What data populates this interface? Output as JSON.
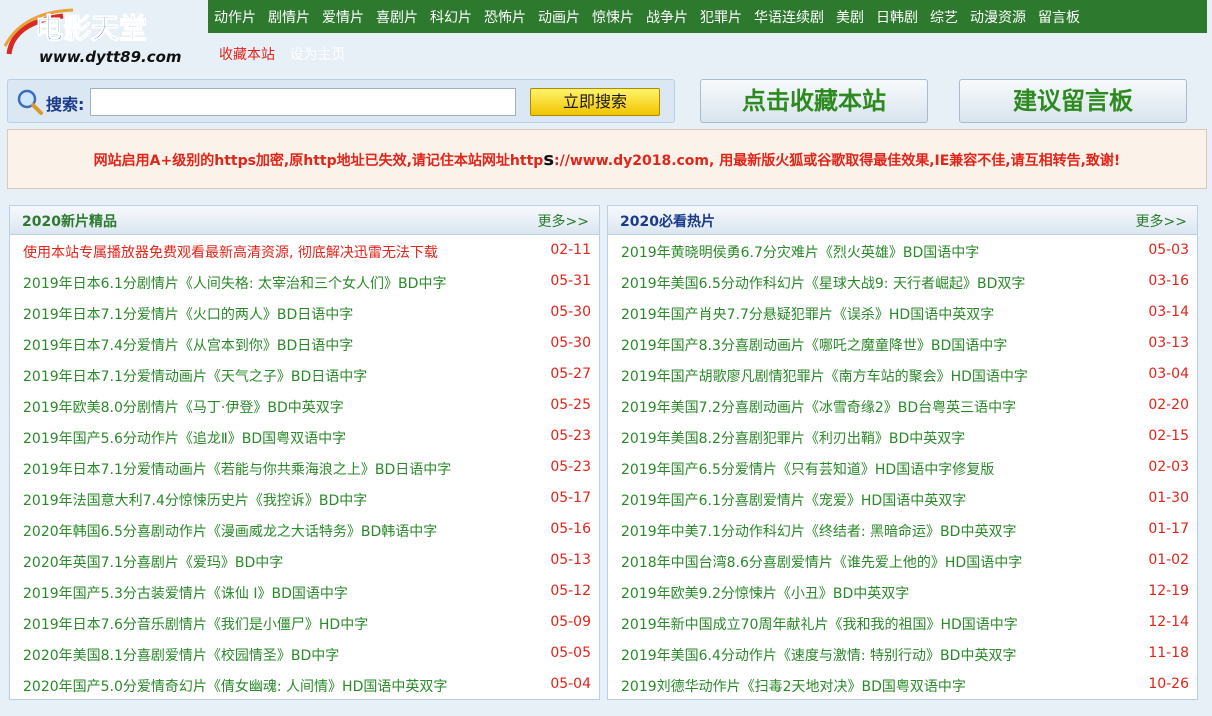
{
  "logo": {
    "text": "电影天堂",
    "url": "www.dytt89.com"
  },
  "nav": [
    "动作片",
    "剧情片",
    "爱情片",
    "喜剧片",
    "科幻片",
    "恐怖片",
    "动画片",
    "惊悚片",
    "战争片",
    "犯罪片",
    "华语连续剧",
    "美剧",
    "日韩剧",
    "综艺",
    "动漫资源",
    "留言板"
  ],
  "sublinks": {
    "bookmark": "收藏本站",
    "homepage": "设为主页"
  },
  "search": {
    "label": "搜索:",
    "placeholder": "",
    "button": "立即搜索"
  },
  "buttons": {
    "bookmark": "点击收藏本站",
    "guestbook": "建议留言板"
  },
  "notice": {
    "part1": "网站启用A+级别的https加密,原http地址已失效,请记住本站网址http",
    "part2": "s",
    "part3": "://www.dy2018.com, 用最新版火狐或谷歌取得最佳效果,IE兼容不佳,请互相转告,致谢!"
  },
  "colors": {
    "nav_bg": "#2d7a2f",
    "link_green": "#2a8a29",
    "date_red": "#e3231a",
    "notice_red": "#e32419"
  },
  "left_panel": {
    "title": "2020新片精品",
    "more": "更多>>",
    "title_color": "#2d7a2f",
    "rows": [
      {
        "title": "使用本站专属播放器免费观看最新高清资源, 彻底解决迅雷无法下载",
        "date": "02-11",
        "highlight": true
      },
      {
        "title": "2019年日本6.1分剧情片《人间失格: 太宰治和三个女人们》BD中字",
        "date": "05-31"
      },
      {
        "title": "2019年日本7.1分爱情片《火口的两人》BD日语中字",
        "date": "05-30"
      },
      {
        "title": "2019年日本7.4分爱情片《从宫本到你》BD日语中字",
        "date": "05-30"
      },
      {
        "title": "2019年日本7.1分爱情动画片《天气之子》BD日语中字",
        "date": "05-27"
      },
      {
        "title": "2019年欧美8.0分剧情片《马丁·伊登》BD中英双字",
        "date": "05-25"
      },
      {
        "title": "2019年国产5.6分动作片《追龙Ⅱ》BD国粤双语中字",
        "date": "05-23"
      },
      {
        "title": "2019年日本7.1分爱情动画片《若能与你共乘海浪之上》BD日语中字",
        "date": "05-23"
      },
      {
        "title": "2019年法国意大利7.4分惊悚历史片《我控诉》BD中字",
        "date": "05-17"
      },
      {
        "title": "2020年韩国6.5分喜剧动作片《漫画威龙之大话特务》BD韩语中字",
        "date": "05-16"
      },
      {
        "title": "2020年英国7.1分喜剧片《爱玛》BD中字",
        "date": "05-13"
      },
      {
        "title": "2019年国产5.3分古装爱情片《诛仙 Ⅰ》BD国语中字",
        "date": "05-12"
      },
      {
        "title": "2019年日本7.6分音乐剧情片《我们是小僵尸》HD中字",
        "date": "05-09"
      },
      {
        "title": "2020年美国8.1分喜剧爱情片《校园情圣》BD中字",
        "date": "05-05"
      },
      {
        "title": "2020年国产5.0分爱情奇幻片《倩女幽魂: 人间情》HD国语中英双字",
        "date": "05-04"
      }
    ]
  },
  "right_panel": {
    "title": "2020必看热片",
    "more": "更多>>",
    "title_color": "#1a3a8a",
    "rows": [
      {
        "title": "2019年黄晓明侯勇6.7分灾难片《烈火英雄》BD国语中字",
        "date": "05-03"
      },
      {
        "title": "2019年美国6.5分动作科幻片《星球大战9: 天行者崛起》BD双字",
        "date": "03-16"
      },
      {
        "title": "2019年国产肖央7.7分悬疑犯罪片《误杀》HD国语中英双字",
        "date": "03-14"
      },
      {
        "title": "2019年国产8.3分喜剧动画片《哪吒之魔童降世》BD国语中字",
        "date": "03-13"
      },
      {
        "title": "2019年国产胡歌廖凡剧情犯罪片《南方车站的聚会》HD国语中字",
        "date": "03-04"
      },
      {
        "title": "2019年美国7.2分喜剧动画片《冰雪奇缘2》BD台粤英三语中字",
        "date": "02-20"
      },
      {
        "title": "2019年美国8.2分喜剧犯罪片《利刃出鞘》BD中英双字",
        "date": "02-15"
      },
      {
        "title": "2019年国产6.5分爱情片《只有芸知道》HD国语中字修复版",
        "date": "02-03"
      },
      {
        "title": "2019年国产6.1分喜剧爱情片《宠爱》HD国语中英双字",
        "date": "01-30"
      },
      {
        "title": "2019年中美7.1分动作科幻片《终结者: 黑暗命运》BD中英双字",
        "date": "01-17"
      },
      {
        "title": "2018年中国台湾8.6分喜剧爱情片《谁先爱上他的》HD国语中字",
        "date": "01-02"
      },
      {
        "title": "2019年欧美9.2分惊悚片《小丑》BD中英双字",
        "date": "12-19"
      },
      {
        "title": "2019年新中国成立70周年献礼片《我和我的祖国》HD国语中字",
        "date": "12-14"
      },
      {
        "title": "2019年美国6.4分动作片《速度与激情: 特别行动》BD中英双字",
        "date": "11-18"
      },
      {
        "title": "2019刘德华动作片《扫毒2天地对决》BD国粤双语中字",
        "date": "10-26"
      }
    ]
  }
}
